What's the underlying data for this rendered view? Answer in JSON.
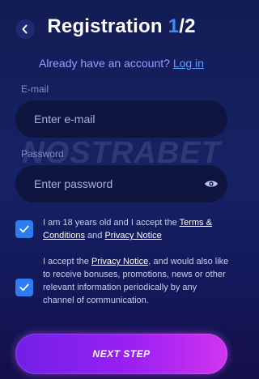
{
  "header": {
    "title": "Registration ",
    "step_current": "1",
    "step_total": "/2"
  },
  "login_prompt": {
    "text": "Already have an account? ",
    "link": "Log in"
  },
  "email": {
    "label": "E-mail",
    "placeholder": "Enter e-mail",
    "value": ""
  },
  "password": {
    "label": "Password",
    "placeholder": "Enter password",
    "value": ""
  },
  "watermark": "NOSTRABET",
  "consents": [
    {
      "checked": true,
      "text_before": "I am 18 years old and I accept the ",
      "link1": "Terms & Conditions",
      "text_mid": " and ",
      "link2": "Privacy Notice"
    },
    {
      "checked": true,
      "text_before": "I accept the ",
      "link1": "Privacy Notice",
      "text_after": ", and would also like to receive bonuses, promotions, news or other relevant information periodically by any channel of communication."
    }
  ],
  "next_button": {
    "label": "NEXT STEP"
  },
  "colors": {
    "accent": "#3c8cff",
    "checkbox": "#2f7cf0",
    "button_start": "#7020e8",
    "button_end": "#d035f0"
  }
}
